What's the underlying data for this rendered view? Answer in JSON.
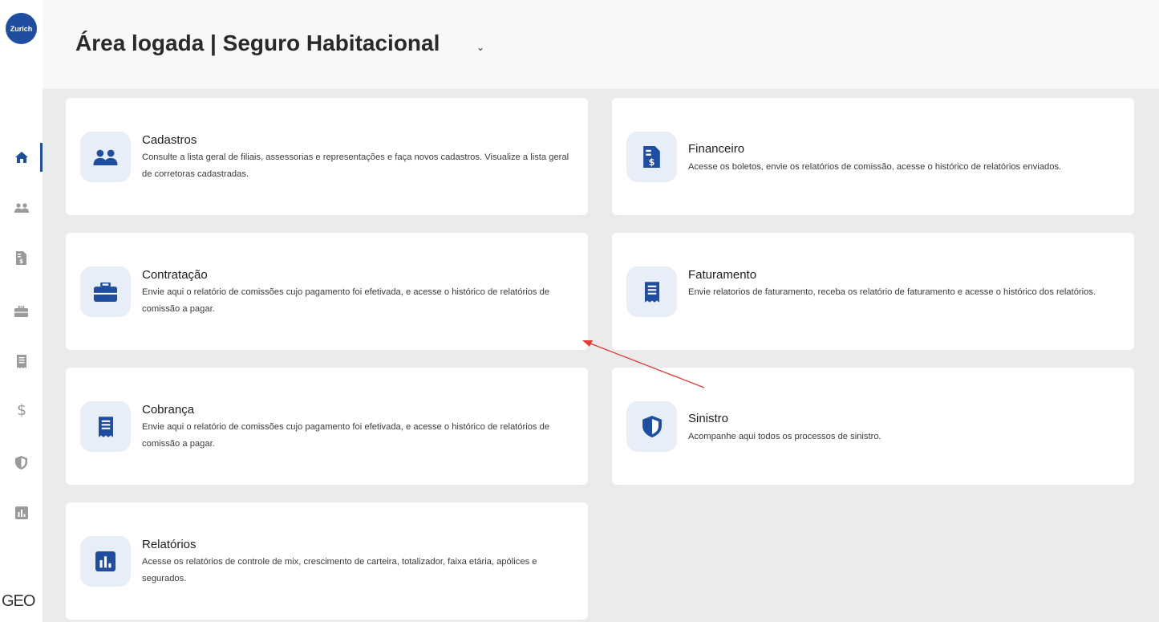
{
  "brand": {
    "logo_text": "Zurich",
    "footer_logo": "GEO"
  },
  "header": {
    "title": "Área logada | Seguro Habitacional",
    "chevron": "⌄"
  },
  "sidebar": {
    "items": [
      {
        "icon": "home-icon",
        "active": true
      },
      {
        "icon": "users-icon"
      },
      {
        "icon": "invoice-icon"
      },
      {
        "icon": "briefcase-icon"
      },
      {
        "icon": "receipt-icon"
      },
      {
        "icon": "dollar-icon"
      },
      {
        "icon": "shield-icon"
      },
      {
        "icon": "chart-icon"
      }
    ]
  },
  "cards": {
    "cadastros": {
      "title": "Cadastros",
      "description": "Consulte a lista geral de filiais, assessorias e representações e faça novos cadastros. Visualize a lista geral de corretoras cadastradas.",
      "icon": "users-icon"
    },
    "financeiro": {
      "title": "Financeiro",
      "description": "Acesse os boletos, envie os relatórios de comissão, acesse o histórico de relatórios enviados.",
      "icon": "invoice-icon"
    },
    "contratacao": {
      "title": "Contratação",
      "description": "Envie aqui o relatório de comissões cujo pagamento foi efetivada, e acesse o histórico de relatórios de comissão a pagar.",
      "icon": "briefcase-icon"
    },
    "faturamento": {
      "title": "Faturamento",
      "description": "Envie relatorios de faturamento, receba os relatório de faturamento e acesse o histórico dos relatórios.",
      "icon": "receipt-icon"
    },
    "cobranca": {
      "title": "Cobrança",
      "description": "Envie aqui o relatório de comissões cujo pagamento foi efetivada, e acesse o histórico de relatórios de comissão a pagar.",
      "icon": "receipt-icon"
    },
    "sinistro": {
      "title": "Sinistro",
      "description": "Acompanhe aqui todos os processos de sinistro.",
      "icon": "shield-icon"
    },
    "relatorios": {
      "title": "Relatórios",
      "description": "Acesse os relatórios de controle de mix, crescimento de carteira, totalizador, faixa etária, apólices e segurados.",
      "icon": "chart-icon"
    }
  },
  "colors": {
    "brand_blue": "#1f4ea0",
    "icon_bg": "#e8eef7",
    "page_bg": "#ebebeb",
    "sidebar_icon": "#9a9a9a",
    "annotation_arrow": "#e53935"
  }
}
